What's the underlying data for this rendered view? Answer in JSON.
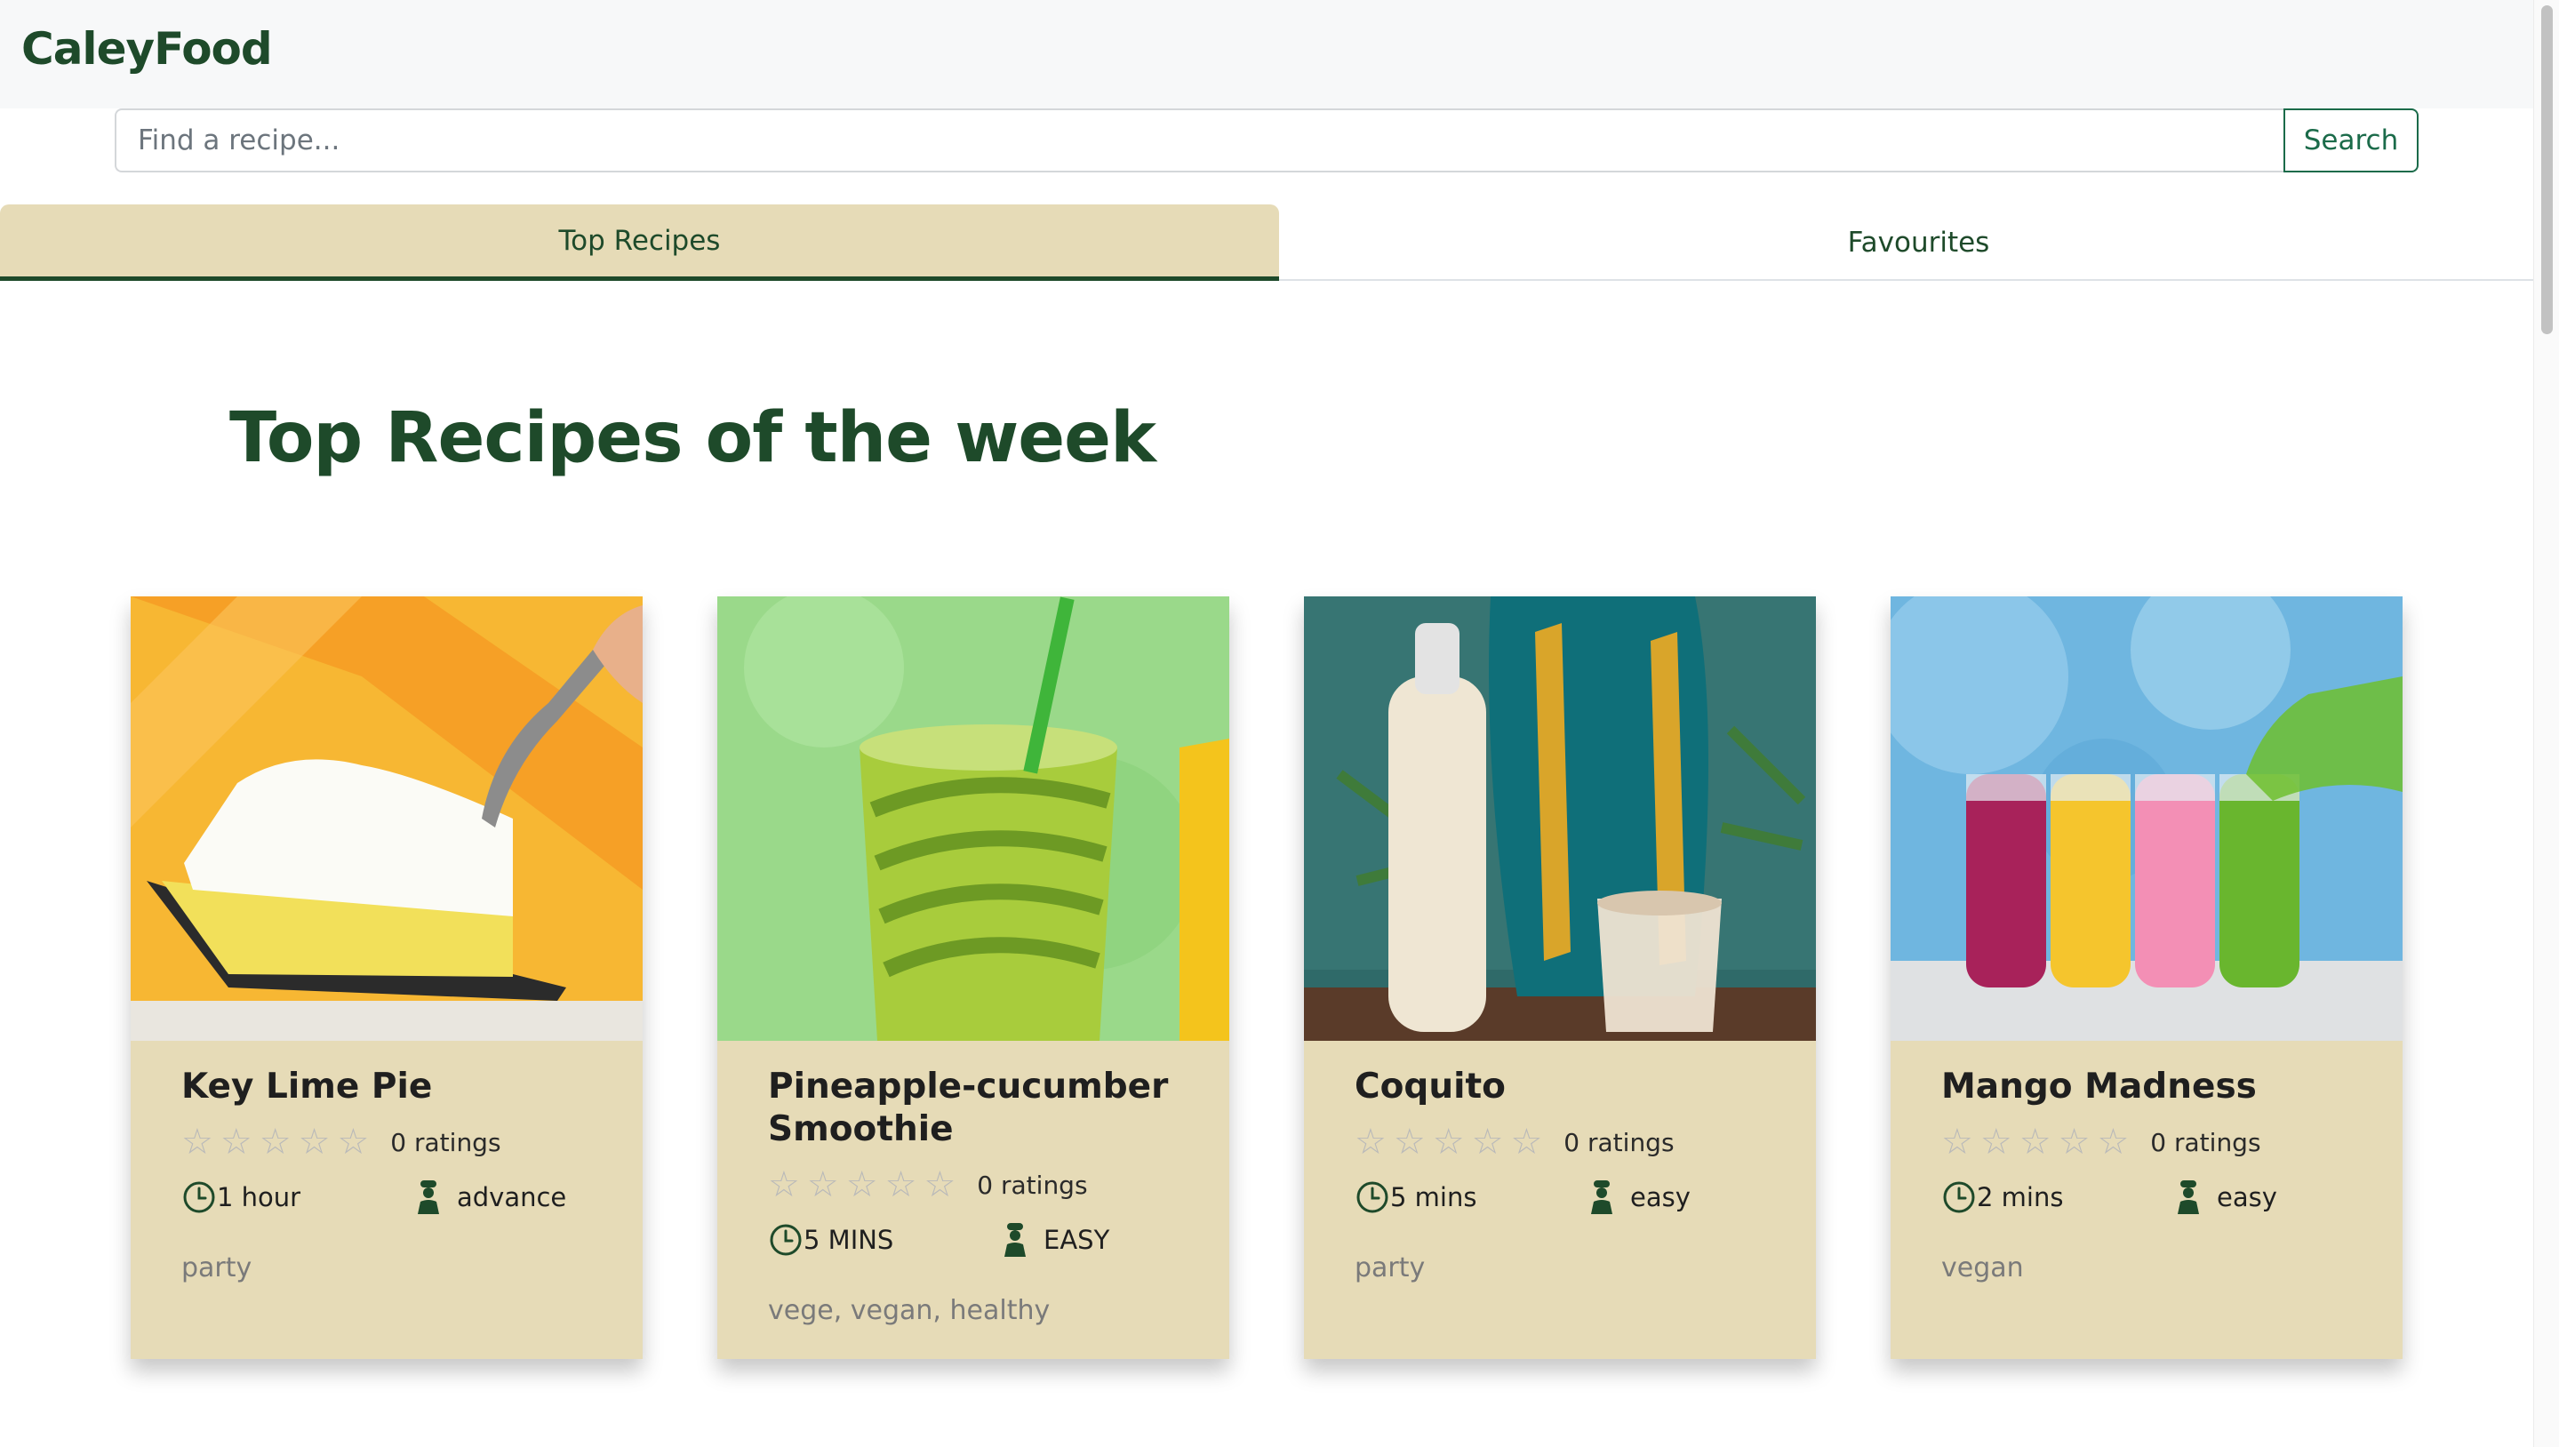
{
  "header": {
    "logo": "CaleyFood"
  },
  "search": {
    "placeholder": "Find a recipe...",
    "button": "Search"
  },
  "tabs": [
    {
      "label": "Top Recipes",
      "active": true
    },
    {
      "label": "Favourites",
      "active": false
    }
  ],
  "section_title": "Top Recipes of the week",
  "recipes": [
    {
      "title": "Key Lime Pie",
      "stars": 0,
      "ratings": "0 ratings",
      "time": "1 hour",
      "difficulty": "advance",
      "tags": "party",
      "image": "key-lime-pie-photo"
    },
    {
      "title": "Pineapple-cucumber Smoothie",
      "stars": 0,
      "ratings": "0 ratings",
      "time": "5 MINS",
      "difficulty": "EASY",
      "tags": "vege, vegan, healthy",
      "image": "pineapple-cucumber-smoothie-photo"
    },
    {
      "title": "Coquito",
      "stars": 0,
      "ratings": "0 ratings",
      "time": "5 mins",
      "difficulty": "easy",
      "tags": "party",
      "image": "coquito-photo"
    },
    {
      "title": "Mango Madness",
      "stars": 0,
      "ratings": "0 ratings",
      "time": "2 mins",
      "difficulty": "easy",
      "tags": "vegan",
      "image": "mango-madness-photo"
    }
  ],
  "colors": {
    "brand_green": "#1e4a2a",
    "search_green": "#1b6b4a",
    "card_bg": "#e6dbb7",
    "tab_active_bg": "#e6dbb7"
  }
}
